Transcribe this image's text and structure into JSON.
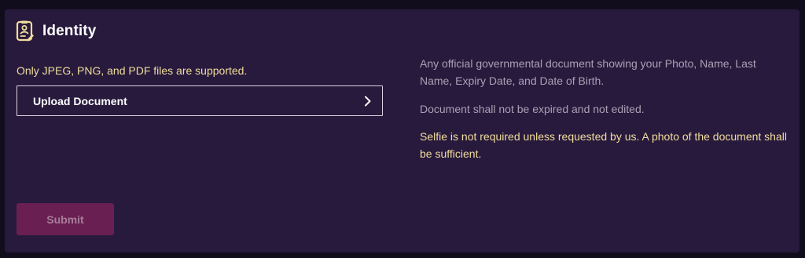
{
  "identity": {
    "title": "Identity",
    "icon": "id-badge-icon",
    "support_note": "Only JPEG, PNG, and PDF files are supported.",
    "upload_label": "Upload Document",
    "submit_label": "Submit",
    "info": {
      "requirement": "Any official governmental document showing your Photo, Name, Last Name, Expiry Date, and Date of Birth.",
      "validity": "Document shall not be expired and not edited.",
      "selfie_note": "Selfie is not required unless requested by us. A photo of the document shall be sufficient."
    }
  },
  "colors": {
    "page_background": "#120d1d",
    "card_background": "#281a3d",
    "accent_yellow": "#f1dd9c",
    "muted_text": "#a8a1b3",
    "submit_disabled_bg": "#6a1f53",
    "submit_disabled_text": "#a77e9a"
  }
}
